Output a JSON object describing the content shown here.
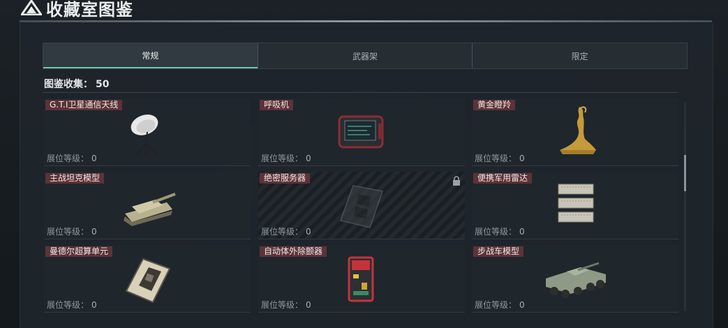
{
  "header": {
    "title": "收藏室图鉴"
  },
  "tabs": [
    {
      "label": "常规",
      "active": true
    },
    {
      "label": "武器架",
      "active": false
    },
    {
      "label": "限定",
      "active": false
    }
  ],
  "collection": {
    "label": "图鉴收集：",
    "count": "50"
  },
  "level_label": "展位等级：",
  "items": [
    {
      "name": "G.T.I卫星通信天线",
      "level": "0",
      "locked": false,
      "icon": "satellite-dish-icon"
    },
    {
      "name": "呼吸机",
      "level": "0",
      "locked": false,
      "icon": "ventilator-icon"
    },
    {
      "name": "黄金瞪羚",
      "level": "0",
      "locked": false,
      "icon": "golden-gazelle-icon"
    },
    {
      "name": "主战坦克模型",
      "level": "0",
      "locked": false,
      "icon": "tank-model-icon"
    },
    {
      "name": "绝密服务器",
      "level": "0",
      "locked": true,
      "icon": "server-icon"
    },
    {
      "name": "便携军用雷达",
      "level": "0",
      "locked": false,
      "icon": "radar-icon"
    },
    {
      "name": "曼德尔超算单元",
      "level": "0",
      "locked": false,
      "icon": "supercomputer-unit-icon"
    },
    {
      "name": "自动体外除颤器",
      "level": "0",
      "locked": false,
      "icon": "defibrillator-icon"
    },
    {
      "name": "步战车模型",
      "level": "0",
      "locked": false,
      "icon": "ifv-model-icon"
    }
  ],
  "colors": {
    "accent": "#6fc4b0",
    "label_bg": "#5b3338"
  }
}
